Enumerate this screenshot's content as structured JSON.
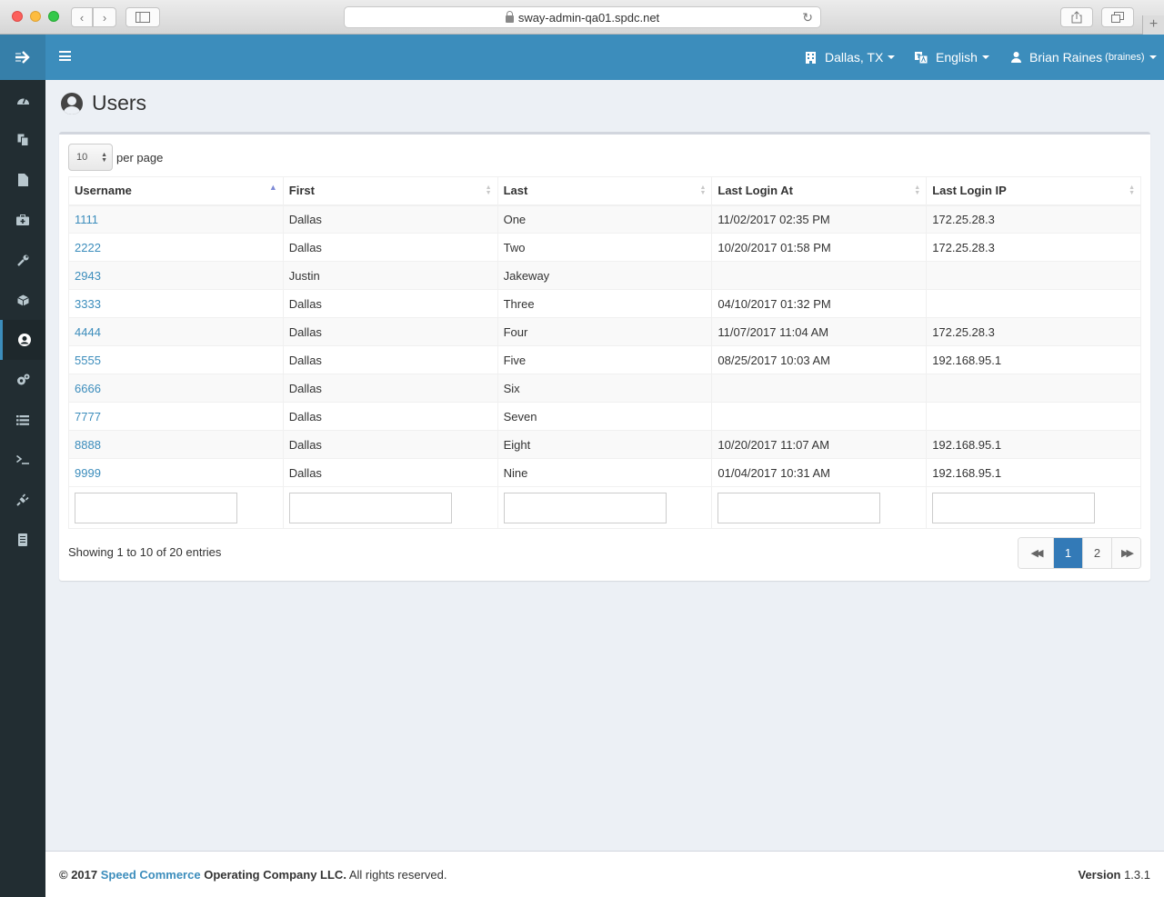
{
  "browser": {
    "url": "sway-admin-qa01.spdc.net"
  },
  "sidebar": {
    "items": [
      {
        "icon": "dashboard-icon"
      },
      {
        "icon": "copy-icon"
      },
      {
        "icon": "file-icon"
      },
      {
        "icon": "medkit-icon"
      },
      {
        "icon": "wrench-icon"
      },
      {
        "icon": "cube-icon"
      },
      {
        "icon": "user-circle-icon",
        "active": true
      },
      {
        "icon": "cogs-icon"
      },
      {
        "icon": "list-icon"
      },
      {
        "icon": "terminal-icon"
      },
      {
        "icon": "plug-icon"
      },
      {
        "icon": "server-icon"
      }
    ]
  },
  "topbar": {
    "location": "Dallas, TX",
    "language": "English",
    "user_name": "Brian Raines",
    "user_login": "(braines)"
  },
  "page": {
    "title": "Users"
  },
  "table": {
    "per_page_value": "10",
    "per_page_label": "per page",
    "columns": [
      "Username",
      "First",
      "Last",
      "Last Login At",
      "Last Login IP"
    ],
    "rows": [
      [
        "1111",
        "Dallas",
        "One",
        "11/02/2017 02:35 PM",
        "172.25.28.3"
      ],
      [
        "2222",
        "Dallas",
        "Two",
        "10/20/2017 01:58 PM",
        "172.25.28.3"
      ],
      [
        "2943",
        "Justin",
        "Jakeway",
        "",
        ""
      ],
      [
        "3333",
        "Dallas",
        "Three",
        "04/10/2017 01:32 PM",
        ""
      ],
      [
        "4444",
        "Dallas",
        "Four",
        "11/07/2017 11:04 AM",
        "172.25.28.3"
      ],
      [
        "5555",
        "Dallas",
        "Five",
        "08/25/2017 10:03 AM",
        "192.168.95.1"
      ],
      [
        "6666",
        "Dallas",
        "Six",
        "",
        ""
      ],
      [
        "7777",
        "Dallas",
        "Seven",
        "",
        ""
      ],
      [
        "8888",
        "Dallas",
        "Eight",
        "10/20/2017 11:07 AM",
        "192.168.95.1"
      ],
      [
        "9999",
        "Dallas",
        "Nine",
        "01/04/2017 10:31 AM",
        "192.168.95.1"
      ]
    ],
    "info": "Showing 1 to 10 of 20 entries",
    "pages": [
      "1",
      "2"
    ],
    "current_page": "1"
  },
  "footer": {
    "copyright_prefix": "© 2017",
    "company_link": "Speed Commerce",
    "company_suffix": "Operating Company LLC.",
    "rights": "All rights reserved.",
    "version_label": "Version",
    "version": "1.3.1"
  },
  "colors": {
    "accent": "#3c8dbc",
    "sidebar": "#222d32",
    "link": "#3c8dbc"
  }
}
